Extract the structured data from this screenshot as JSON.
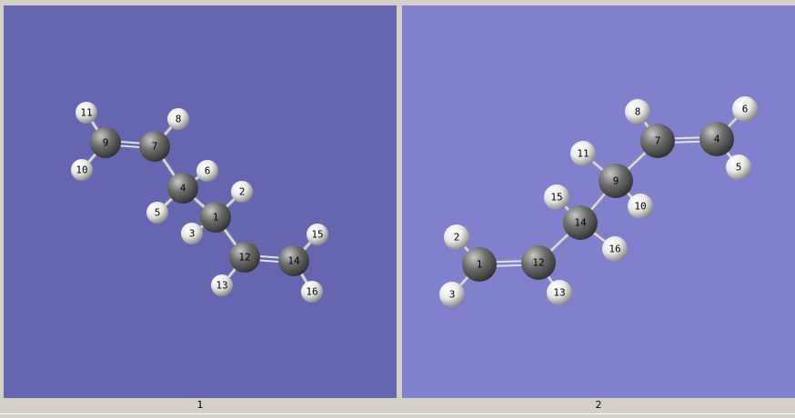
{
  "colors": {
    "panel1_bg": "#6666b0",
    "panel2_bg": "#8080cc",
    "carbon": "#6e6e6e",
    "hydrogen": "#e8e8e8",
    "bond": "#e0e0e8"
  },
  "views": [
    {
      "label": "1",
      "atoms": [
        {
          "n": "1",
          "el": "C"
        },
        {
          "n": "2",
          "el": "H"
        },
        {
          "n": "3",
          "el": "H"
        },
        {
          "n": "4",
          "el": "C"
        },
        {
          "n": "5",
          "el": "H"
        },
        {
          "n": "6",
          "el": "H"
        },
        {
          "n": "7",
          "el": "C"
        },
        {
          "n": "8",
          "el": "H"
        },
        {
          "n": "9",
          "el": "C"
        },
        {
          "n": "10",
          "el": "H"
        },
        {
          "n": "11",
          "el": "H"
        },
        {
          "n": "12",
          "el": "C"
        },
        {
          "n": "13",
          "el": "H"
        },
        {
          "n": "14",
          "el": "C"
        },
        {
          "n": "15",
          "el": "H"
        },
        {
          "n": "16",
          "el": "H"
        }
      ],
      "bonds": [
        [
          "9",
          "7",
          2
        ],
        [
          "9",
          "11",
          1
        ],
        [
          "9",
          "10",
          1
        ],
        [
          "7",
          "8",
          1
        ],
        [
          "7",
          "4",
          1
        ],
        [
          "4",
          "6",
          1
        ],
        [
          "4",
          "5",
          1
        ],
        [
          "4",
          "1",
          1
        ],
        [
          "1",
          "2",
          1
        ],
        [
          "1",
          "3",
          1
        ],
        [
          "1",
          "12",
          1
        ],
        [
          "12",
          "13",
          1
        ],
        [
          "12",
          "14",
          2
        ],
        [
          "14",
          "15",
          1
        ],
        [
          "14",
          "16",
          1
        ]
      ]
    },
    {
      "label": "2",
      "atoms": [
        {
          "n": "1",
          "el": "C"
        },
        {
          "n": "2",
          "el": "H"
        },
        {
          "n": "3",
          "el": "H"
        },
        {
          "n": "4",
          "el": "C"
        },
        {
          "n": "5",
          "el": "H"
        },
        {
          "n": "6",
          "el": "H"
        },
        {
          "n": "7",
          "el": "C"
        },
        {
          "n": "8",
          "el": "H"
        },
        {
          "n": "9",
          "el": "C"
        },
        {
          "n": "10",
          "el": "H"
        },
        {
          "n": "11",
          "el": "H"
        },
        {
          "n": "12",
          "el": "C"
        },
        {
          "n": "13",
          "el": "H"
        },
        {
          "n": "14",
          "el": "C"
        },
        {
          "n": "15",
          "el": "H"
        },
        {
          "n": "16",
          "el": "H"
        }
      ],
      "bonds": [
        [
          "4",
          "7",
          2
        ],
        [
          "4",
          "6",
          1
        ],
        [
          "4",
          "5",
          1
        ],
        [
          "7",
          "8",
          1
        ],
        [
          "7",
          "9",
          1
        ],
        [
          "9",
          "11",
          1
        ],
        [
          "9",
          "10",
          1
        ],
        [
          "9",
          "14",
          1
        ],
        [
          "14",
          "15",
          1
        ],
        [
          "14",
          "16",
          1
        ],
        [
          "14",
          "12",
          1
        ],
        [
          "12",
          "13",
          1
        ],
        [
          "12",
          "1",
          2
        ],
        [
          "1",
          "2",
          1
        ],
        [
          "1",
          "3",
          1
        ]
      ]
    }
  ]
}
